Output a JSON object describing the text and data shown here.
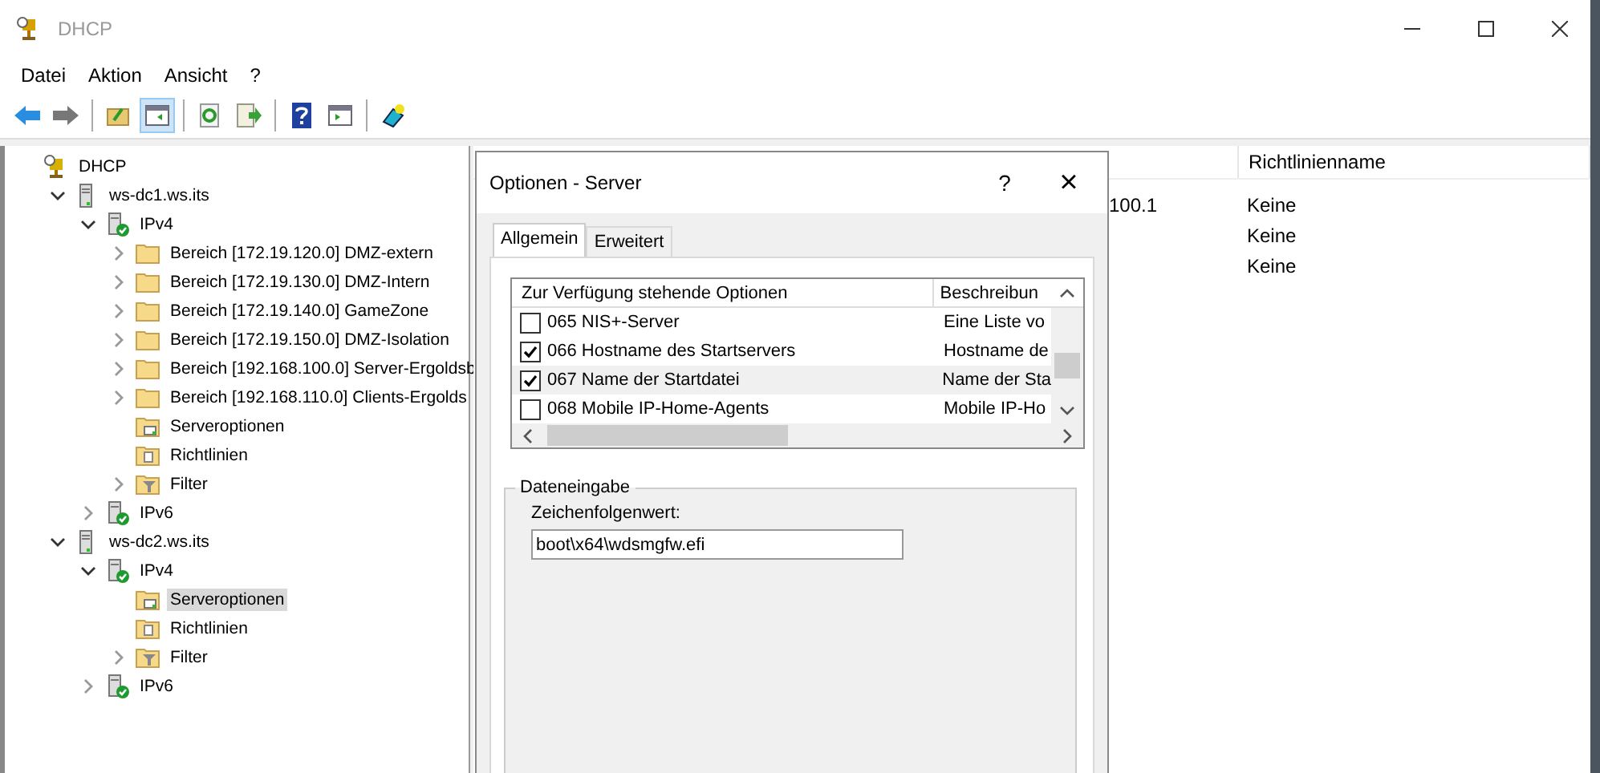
{
  "window": {
    "title": "DHCP"
  },
  "menu": [
    "Datei",
    "Aktion",
    "Ansicht",
    "?"
  ],
  "toolbar": [
    {
      "kind": "back",
      "pressed": false
    },
    {
      "kind": "forward",
      "pressed": false
    },
    {
      "kind": "separator"
    },
    {
      "kind": "up",
      "pressed": false
    },
    {
      "kind": "tree",
      "pressed": true
    },
    {
      "kind": "separator"
    },
    {
      "kind": "refresh",
      "pressed": false
    },
    {
      "kind": "export",
      "pressed": false
    },
    {
      "kind": "separator"
    },
    {
      "kind": "help",
      "pressed": false
    },
    {
      "kind": "pane",
      "pressed": false
    },
    {
      "kind": "separator"
    },
    {
      "kind": "plugin",
      "pressed": false
    }
  ],
  "tree": [
    {
      "label": "DHCP",
      "kind": "dhcp",
      "selected": false,
      "children": [
        {
          "label": "ws-dc1.ws.its",
          "kind": "server",
          "expanded": true,
          "selected": false,
          "children": [
            {
              "label": "IPv4",
              "kind": "protocol",
              "expanded": true,
              "selected": false,
              "children": [
                {
                  "label": "Bereich [172.19.120.0] DMZ-extern",
                  "kind": "folder",
                  "expanded": false,
                  "selected": false
                },
                {
                  "label": "Bereich [172.19.130.0] DMZ-Intern",
                  "kind": "folder",
                  "expanded": false,
                  "selected": false
                },
                {
                  "label": "Bereich [172.19.140.0] GameZone",
                  "kind": "folder",
                  "expanded": false,
                  "selected": false
                },
                {
                  "label": "Bereich [172.19.150.0] DMZ-Isolation",
                  "kind": "folder",
                  "expanded": false,
                  "selected": false
                },
                {
                  "label": "Bereich [192.168.100.0] Server-Ergoldsb",
                  "kind": "folder",
                  "expanded": false,
                  "selected": false
                },
                {
                  "label": "Bereich [192.168.110.0] Clients-Ergolds",
                  "kind": "folder",
                  "expanded": false,
                  "selected": false
                },
                {
                  "label": "Serveroptionen",
                  "kind": "options",
                  "selected": false
                },
                {
                  "label": "Richtlinien",
                  "kind": "policies",
                  "selected": false
                },
                {
                  "label": "Filter",
                  "kind": "filter",
                  "expanded": false,
                  "selected": false
                }
              ]
            },
            {
              "label": "IPv6",
              "kind": "protocol",
              "expanded": false,
              "selected": false
            }
          ]
        },
        {
          "label": "ws-dc2.ws.its",
          "kind": "server",
          "expanded": true,
          "selected": false,
          "children": [
            {
              "label": "IPv4",
              "kind": "protocol",
              "expanded": true,
              "selected": false,
              "children": [
                {
                  "label": "Serveroptionen",
                  "kind": "options",
                  "selected": true
                },
                {
                  "label": "Richtlinien",
                  "kind": "policies",
                  "selected": false
                },
                {
                  "label": "Filter",
                  "kind": "filter",
                  "expanded": false,
                  "selected": false
                }
              ]
            },
            {
              "label": "IPv6",
              "kind": "protocol",
              "expanded": false,
              "selected": false
            }
          ]
        }
      ]
    }
  ],
  "list": {
    "header": "Richtlinienname",
    "rows": [
      {
        "column_1": "100.1",
        "policy": "Keine"
      },
      {
        "policy": "Keine"
      },
      {
        "policy": "Keine"
      }
    ]
  },
  "dialog": {
    "title": "Optionen - Server",
    "help": "?",
    "close": "×",
    "tabs": [
      {
        "label": "Allgemein",
        "selected": true
      },
      {
        "label": "Erweitert",
        "selected": false
      }
    ],
    "options": {
      "columns": [
        "Zur Verfügung stehende Optionen",
        "Beschreibun"
      ],
      "rows": [
        {
          "name": "065 NIS+-Server",
          "description": "Eine Liste vo",
          "checked": false,
          "selected": false
        },
        {
          "name": "066 Hostname des Startservers",
          "description": "Hostname de",
          "checked": true,
          "selected": false
        },
        {
          "name": "067 Name der Startdatei",
          "description": "Name der Sta",
          "checked": true,
          "selected": true
        },
        {
          "name": "068 Mobile IP-Home-Agents",
          "description": "Mobile IP-Ho",
          "checked": false,
          "selected": false
        }
      ]
    },
    "group": {
      "title": "Dateneingabe",
      "label": "Zeichenfolgenwert:",
      "value": "boot\\x64\\wdsmgfw.efi"
    }
  }
}
